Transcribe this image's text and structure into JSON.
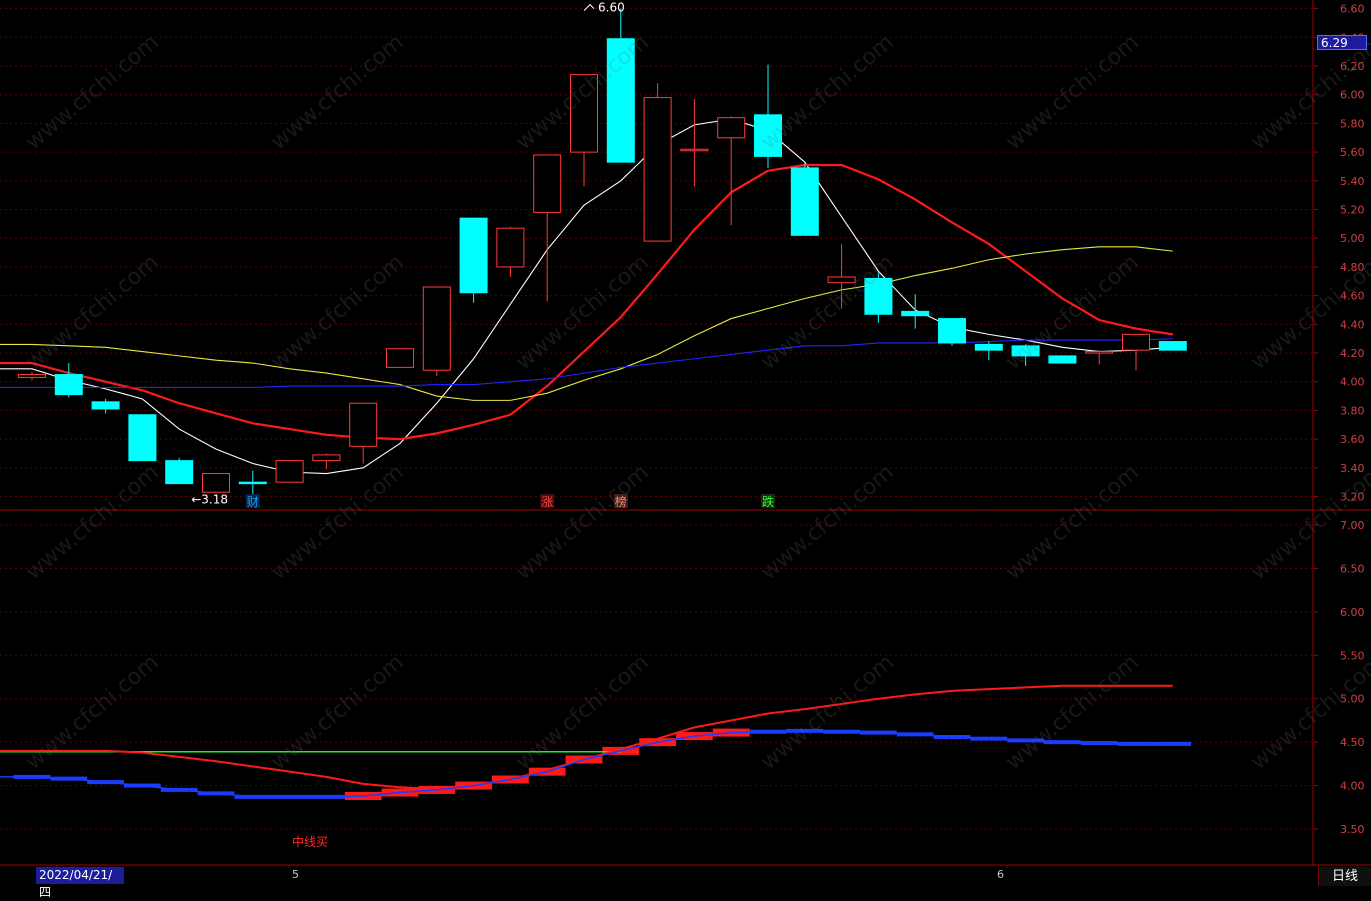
{
  "chart_data": [
    {
      "type": "candlestick",
      "panel": "price",
      "y_axis_ticks": [
        "6.60",
        "6.40",
        "6.20",
        "6.00",
        "5.80",
        "5.60",
        "5.40",
        "5.20",
        "5.00",
        "4.80",
        "4.60",
        "4.40",
        "4.20",
        "4.00",
        "3.80",
        "3.60",
        "3.40",
        "3.20"
      ],
      "ylim": [
        3.12,
        6.66
      ],
      "current_price": "6.29",
      "high_annotation": "6.60",
      "low_annotation": "←3.18",
      "candles": [
        {
          "o": 4.03,
          "h": 4.07,
          "l": 4.01,
          "c": 4.05,
          "bull": true
        },
        {
          "o": 4.05,
          "h": 4.13,
          "l": 3.89,
          "c": 3.91,
          "bull": false
        },
        {
          "o": 3.86,
          "h": 3.88,
          "l": 3.78,
          "c": 3.81,
          "bull": false
        },
        {
          "o": 3.77,
          "h": 3.77,
          "l": 3.45,
          "c": 3.45,
          "bull": false
        },
        {
          "o": 3.45,
          "h": 3.47,
          "l": 3.29,
          "c": 3.29,
          "bull": false
        },
        {
          "o": 3.23,
          "h": 3.36,
          "l": 3.23,
          "c": 3.36,
          "bull": true
        },
        {
          "o": 3.3,
          "h": 3.38,
          "l": 3.18,
          "c": 3.3,
          "bull": false
        },
        {
          "o": 3.3,
          "h": 3.45,
          "l": 3.3,
          "c": 3.45,
          "bull": true
        },
        {
          "o": 3.45,
          "h": 3.5,
          "l": 3.39,
          "c": 3.49,
          "bull": true
        },
        {
          "o": 3.55,
          "h": 3.85,
          "l": 3.43,
          "c": 3.85,
          "bull": true
        },
        {
          "o": 4.1,
          "h": 4.23,
          "l": 4.1,
          "c": 4.23,
          "bull": true
        },
        {
          "o": 4.08,
          "h": 4.66,
          "l": 4.04,
          "c": 4.66,
          "bull": true
        },
        {
          "o": 5.14,
          "h": 5.14,
          "l": 4.55,
          "c": 4.62,
          "bull": false
        },
        {
          "o": 4.8,
          "h": 5.08,
          "l": 4.73,
          "c": 5.07,
          "bull": true
        },
        {
          "o": 5.18,
          "h": 5.58,
          "l": 4.56,
          "c": 5.58,
          "bull": true
        },
        {
          "o": 5.6,
          "h": 6.14,
          "l": 5.36,
          "c": 6.14,
          "bull": true
        },
        {
          "o": 6.39,
          "h": 6.6,
          "l": 5.53,
          "c": 5.53,
          "bull": false
        },
        {
          "o": 4.98,
          "h": 6.08,
          "l": 4.98,
          "c": 5.98,
          "bull": true
        },
        {
          "o": 5.61,
          "h": 5.97,
          "l": 5.36,
          "c": 5.62,
          "bull": true
        },
        {
          "o": 5.7,
          "h": 5.85,
          "l": 5.09,
          "c": 5.84,
          "bull": true
        },
        {
          "o": 5.86,
          "h": 6.21,
          "l": 5.49,
          "c": 5.57,
          "bull": false
        },
        {
          "o": 5.49,
          "h": 5.52,
          "l": 5.02,
          "c": 5.02,
          "bull": false
        },
        {
          "o": 4.69,
          "h": 4.96,
          "l": 4.51,
          "c": 4.73,
          "bull": true
        },
        {
          "o": 4.72,
          "h": 4.76,
          "l": 4.41,
          "c": 4.47,
          "bull": false
        },
        {
          "o": 4.49,
          "h": 4.61,
          "l": 4.37,
          "c": 4.46,
          "bull": false
        },
        {
          "o": 4.44,
          "h": 4.44,
          "l": 4.25,
          "c": 4.27,
          "bull": false
        },
        {
          "o": 4.26,
          "h": 4.28,
          "l": 4.15,
          "c": 4.22,
          "bull": false
        },
        {
          "o": 4.25,
          "h": 4.26,
          "l": 4.11,
          "c": 4.18,
          "bull": false
        },
        {
          "o": 4.18,
          "h": 4.18,
          "l": 4.13,
          "c": 4.13,
          "bull": false
        },
        {
          "o": 4.2,
          "h": 4.22,
          "l": 4.12,
          "c": 4.21,
          "bull": true
        },
        {
          "o": 4.22,
          "h": 4.33,
          "l": 4.08,
          "c": 4.33,
          "bull": true
        },
        {
          "o": 4.28,
          "h": 4.28,
          "l": 4.22,
          "c": 4.22,
          "bull": false
        }
      ],
      "ma_lines": [
        {
          "color": "#ffffff",
          "values": [
            4.09,
            4.01,
            3.95,
            3.88,
            3.67,
            3.53,
            3.43,
            3.37,
            3.36,
            3.4,
            3.57,
            3.85,
            4.16,
            4.54,
            4.92,
            5.23,
            5.4,
            5.65,
            5.79,
            5.83,
            5.75,
            5.53,
            5.15,
            4.77,
            4.5,
            4.38,
            4.33,
            4.29,
            4.24,
            4.21,
            4.22,
            4.24
          ]
        },
        {
          "color": "#ff1a1a",
          "values": [
            4.13,
            4.06,
            4.0,
            3.94,
            3.85,
            3.78,
            3.71,
            3.67,
            3.63,
            3.61,
            3.6,
            3.64,
            3.7,
            3.77,
            3.97,
            4.21,
            4.45,
            4.75,
            5.06,
            5.32,
            5.47,
            5.51,
            5.51,
            5.41,
            5.27,
            5.11,
            4.96,
            4.77,
            4.58,
            4.43,
            4.37,
            4.33
          ]
        },
        {
          "color": "#e8e840",
          "values": [
            4.26,
            4.25,
            4.24,
            4.21,
            4.18,
            4.15,
            4.13,
            4.09,
            4.06,
            4.02,
            3.98,
            3.9,
            3.87,
            3.87,
            3.92,
            4.01,
            4.09,
            4.19,
            4.32,
            4.44,
            4.51,
            4.58,
            4.64,
            4.68,
            4.74,
            4.79,
            4.85,
            4.89,
            4.92,
            4.94,
            4.94,
            4.91
          ]
        },
        {
          "color": "#2323ff",
          "values": [
            3.96,
            3.96,
            3.96,
            3.96,
            3.96,
            3.96,
            3.96,
            3.97,
            3.97,
            3.97,
            3.97,
            3.98,
            3.98,
            4.0,
            4.02,
            4.06,
            4.1,
            4.13,
            4.16,
            4.19,
            4.22,
            4.25,
            4.25,
            4.27,
            4.27,
            4.27,
            4.28,
            4.29,
            4.29,
            4.29,
            4.29,
            4.3
          ]
        }
      ],
      "event_markers": [
        {
          "label": "财",
          "index": 6,
          "color": "#00a8ff",
          "bg": "#102040"
        },
        {
          "label": "涨",
          "index": 14,
          "color": "#ff4040",
          "bg": "#401010"
        },
        {
          "label": "榜",
          "index": 16,
          "color": "#ff8080",
          "bg": "#402010"
        },
        {
          "label": "跌",
          "index": 20,
          "color": "#30ff30",
          "bg": "#103010"
        }
      ]
    },
    {
      "type": "line",
      "panel": "indicator",
      "y_axis_ticks": [
        "7.00",
        "6.50",
        "6.00",
        "5.50",
        "5.00",
        "4.50",
        "4.00",
        "3.50"
      ],
      "ylim": [
        3.12,
        7.15
      ],
      "signal_label": "中线买",
      "series": [
        {
          "color": "#ff1a1a",
          "values": [
            4.4,
            4.4,
            4.4,
            4.38,
            4.33,
            4.28,
            4.22,
            4.16,
            4.1,
            4.02,
            3.98,
            3.96,
            4.0,
            4.07,
            4.18,
            4.3,
            4.42,
            4.54,
            4.67,
            4.75,
            4.83,
            4.88,
            4.94,
            5.0,
            5.05,
            5.09,
            5.11,
            5.13,
            5.15,
            5.15,
            5.15,
            5.15
          ]
        },
        {
          "color": "#1a3cff",
          "values": [
            4.1,
            4.08,
            4.04,
            4.0,
            3.95,
            3.91,
            3.87,
            3.87,
            3.87,
            3.88,
            3.92,
            3.95,
            4.0,
            4.07,
            4.16,
            4.3,
            4.4,
            4.5,
            4.57,
            4.61,
            4.62,
            4.63,
            4.62,
            4.61,
            4.59,
            4.56,
            4.54,
            4.52,
            4.5,
            4.49,
            4.48,
            4.48
          ]
        },
        {
          "color": "#22ee22",
          "values": [
            4.39,
            4.39,
            4.39,
            4.39,
            4.39,
            4.39,
            4.39,
            4.39,
            4.39,
            4.39,
            4.39,
            4.39,
            4.39,
            4.39,
            4.39,
            4.39,
            4.39
          ]
        }
      ]
    }
  ],
  "bottom_bar": {
    "date": "2022/04/21/四",
    "months": [
      "5",
      "6"
    ],
    "period": "日线"
  },
  "watermark": "www.cfchi.com"
}
